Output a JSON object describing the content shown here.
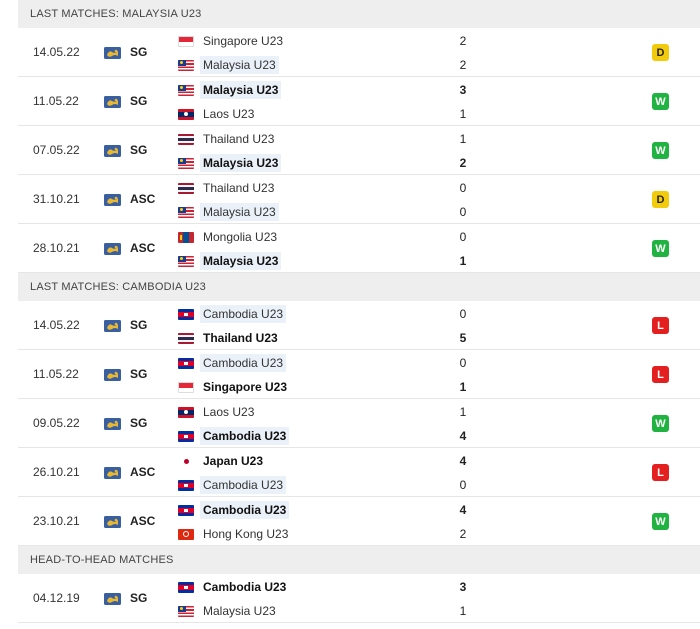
{
  "colors": {
    "header_bg": "#eeeeee",
    "win": "#21b341",
    "draw": "#f2cc0c",
    "loss": "#e41f1f",
    "highlight": "#eaf1f8"
  },
  "sections": [
    {
      "title": "LAST MATCHES: MALAYSIA U23",
      "matches": [
        {
          "date": "14.05.22",
          "comp": "SG",
          "home": "Singapore U23",
          "home_flag": "singapore",
          "home_score": "2",
          "away": "Malaysia U23",
          "away_flag": "malaysia",
          "away_score": "2",
          "result": "D",
          "highlight": "away",
          "bold": ""
        },
        {
          "date": "11.05.22",
          "comp": "SG",
          "home": "Malaysia U23",
          "home_flag": "malaysia",
          "home_score": "3",
          "away": "Laos U23",
          "away_flag": "laos",
          "away_score": "1",
          "result": "W",
          "highlight": "home",
          "bold": "home"
        },
        {
          "date": "07.05.22",
          "comp": "SG",
          "home": "Thailand U23",
          "home_flag": "thailand",
          "home_score": "1",
          "away": "Malaysia U23",
          "away_flag": "malaysia",
          "away_score": "2",
          "result": "W",
          "highlight": "away",
          "bold": "away"
        },
        {
          "date": "31.10.21",
          "comp": "ASC",
          "home": "Thailand U23",
          "home_flag": "thailand",
          "home_score": "0",
          "away": "Malaysia U23",
          "away_flag": "malaysia",
          "away_score": "0",
          "result": "D",
          "highlight": "away",
          "bold": ""
        },
        {
          "date": "28.10.21",
          "comp": "ASC",
          "home": "Mongolia U23",
          "home_flag": "mongolia",
          "home_score": "0",
          "away": "Malaysia U23",
          "away_flag": "malaysia",
          "away_score": "1",
          "result": "W",
          "highlight": "away",
          "bold": "away"
        }
      ]
    },
    {
      "title": "LAST MATCHES: CAMBODIA U23",
      "matches": [
        {
          "date": "14.05.22",
          "comp": "SG",
          "home": "Cambodia U23",
          "home_flag": "cambodia",
          "home_score": "0",
          "away": "Thailand U23",
          "away_flag": "thailand",
          "away_score": "5",
          "result": "L",
          "highlight": "home",
          "bold": "away"
        },
        {
          "date": "11.05.22",
          "comp": "SG",
          "home": "Cambodia U23",
          "home_flag": "cambodia",
          "home_score": "0",
          "away": "Singapore U23",
          "away_flag": "singapore",
          "away_score": "1",
          "result": "L",
          "highlight": "home",
          "bold": "away"
        },
        {
          "date": "09.05.22",
          "comp": "SG",
          "home": "Laos U23",
          "home_flag": "laos",
          "home_score": "1",
          "away": "Cambodia U23",
          "away_flag": "cambodia",
          "away_score": "4",
          "result": "W",
          "highlight": "away",
          "bold": "away"
        },
        {
          "date": "26.10.21",
          "comp": "ASC",
          "home": "Japan U23",
          "home_flag": "japan",
          "home_score": "4",
          "away": "Cambodia U23",
          "away_flag": "cambodia",
          "away_score": "0",
          "result": "L",
          "highlight": "away",
          "bold": "home"
        },
        {
          "date": "23.10.21",
          "comp": "ASC",
          "home": "Cambodia U23",
          "home_flag": "cambodia",
          "home_score": "4",
          "away": "Hong Kong U23",
          "away_flag": "hongkong",
          "away_score": "2",
          "result": "W",
          "highlight": "home",
          "bold": "home"
        }
      ]
    },
    {
      "title": "HEAD-TO-HEAD MATCHES",
      "matches": [
        {
          "date": "04.12.19",
          "comp": "SG",
          "home": "Cambodia U23",
          "home_flag": "cambodia",
          "home_score": "3",
          "away": "Malaysia U23",
          "away_flag": "malaysia",
          "away_score": "1",
          "result": "",
          "highlight": "",
          "bold": "home"
        }
      ]
    }
  ]
}
